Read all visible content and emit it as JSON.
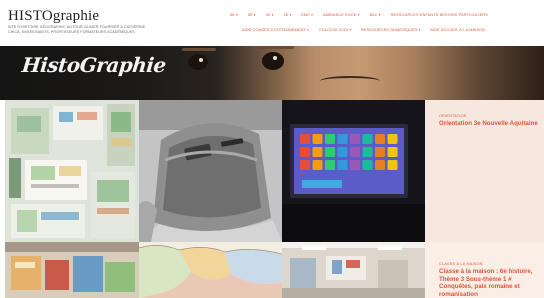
{
  "site": {
    "title": "HISTOgraphie",
    "description": "Site d'histoire géographie, autour Olivier Fourrier & Catherine Chica, enseignants, professeurs formateurs académiques"
  },
  "nav": {
    "row1": [
      {
        "label": "6e",
        "caret": true
      },
      {
        "label": "5e",
        "caret": true
      },
      {
        "label": "4e",
        "caret": true
      },
      {
        "label": "3e",
        "caret": true
      },
      {
        "label": "EMC",
        "caret": true
      },
      {
        "label": "Ambiance EGCE",
        "caret": true
      },
      {
        "label": "Bac",
        "caret": true
      },
      {
        "label": "Ressources enfants besoins particuliers",
        "caret": false
      }
    ],
    "row2": [
      {
        "label": "Aide conseils entraînement",
        "caret": true
      },
      {
        "label": "Collège 2019",
        "caret": true
      },
      {
        "label": "Ressources numériques",
        "caret": true
      },
      {
        "label": "Aide accueil à la maison",
        "caret": false
      }
    ]
  },
  "banner": {
    "logo_text": "HistoGraphie"
  },
  "posts": [
    {
      "category": "Orientation",
      "title": "Orientation 3e Nouvelle Aquitaine"
    },
    {
      "category": "Classe à la maison",
      "title": "Classe à la maison : 6e histoire, Thème 3 Sous-thème 1 # Conquêtes, paix romaine et romanisation"
    }
  ],
  "colors": {
    "accent": "#d9563a",
    "header_bg": "#ffffff",
    "card_bg": "#f6e8df"
  }
}
